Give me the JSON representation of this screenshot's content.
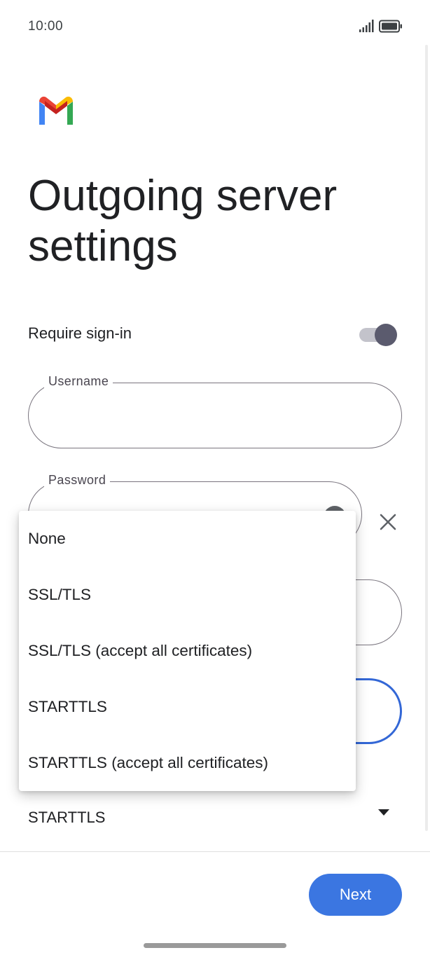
{
  "status_bar": {
    "time": "10:00",
    "signal_icon": "signal-bars-icon",
    "battery_icon": "battery-full-icon"
  },
  "app": {
    "logo_icon": "gmail-logo-icon",
    "title": "Outgoing server settings"
  },
  "form": {
    "require_signin_label": "Require sign-in",
    "require_signin_enabled": true,
    "username_label": "Username",
    "username_value": "",
    "password_label": "Password",
    "password_value": "",
    "security_value": "STARTTLS"
  },
  "dropdown": {
    "options": [
      "None",
      "SSL/TLS",
      "SSL/TLS (accept all certificates)",
      "STARTTLS",
      "STARTTLS (accept all certificates)"
    ]
  },
  "footer": {
    "next_label": "Next"
  },
  "colors": {
    "accent": "#3b76e1",
    "toggle_thumb": "#5b5b6e",
    "toggle_track": "#c3c3cb",
    "gmail_blue": "#4285f4",
    "gmail_red": "#ea4335",
    "gmail_yellow": "#fbbc04",
    "gmail_green": "#34a853"
  }
}
